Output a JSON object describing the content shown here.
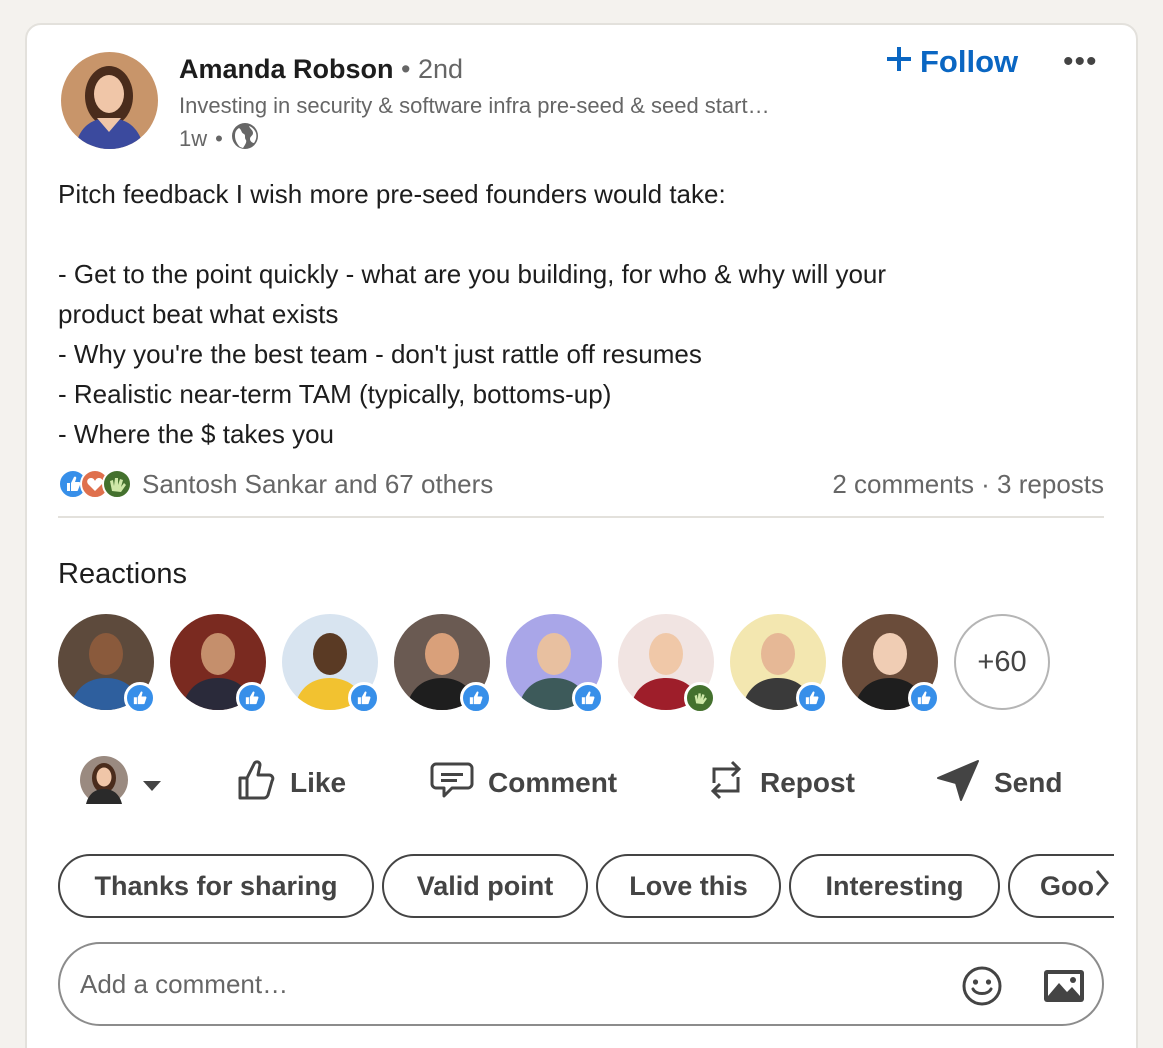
{
  "post": {
    "author_name": "Amanda Robson",
    "author_degree": "• 2nd",
    "author_headline": "Investing in security & software infra pre-seed & seed start…",
    "time": "1w",
    "meta_separator": "•",
    "follow_label": "Follow",
    "more_label": "•••",
    "body_lines": [
      "Pitch feedback I wish more pre-seed founders would take:",
      "",
      "- Get to the point quickly - what are you building, for who & why will your",
      "product beat what exists",
      "- Why you're the best team - don't just rattle off resumes",
      "- Realistic near-term TAM (typically, bottoms-up)",
      "- Where the $ takes you"
    ]
  },
  "social": {
    "reactors_text": "Santosh Sankar and 67 others",
    "counts_text": "2 comments · 3 reposts",
    "reaction_icons": [
      "like-icon",
      "love-icon",
      "celebrate-icon"
    ]
  },
  "reactions": {
    "title": "Reactions",
    "more_count": "+60",
    "people": [
      {
        "reaction": "like",
        "bg": "#5d4a3c",
        "skin": "#8a5a3c",
        "shirt": "#2e5f9e"
      },
      {
        "reaction": "like",
        "bg": "#7a2a20",
        "skin": "#c58f6c",
        "shirt": "#2a2a3a"
      },
      {
        "reaction": "like",
        "bg": "#d8e4f0",
        "skin": "#5a3a24",
        "shirt": "#f2c230"
      },
      {
        "reaction": "like",
        "bg": "#6a5a52",
        "skin": "#d9a07a",
        "shirt": "#1e1e1e"
      },
      {
        "reaction": "like",
        "bg": "#a9a6e8",
        "skin": "#e8c0a0",
        "shirt": "#3d5a5a"
      },
      {
        "reaction": "celebrate",
        "bg": "#f1e4e2",
        "skin": "#f0c8a8",
        "shirt": "#9e1e2a"
      },
      {
        "reaction": "like",
        "bg": "#f3e7b0",
        "skin": "#e6b896",
        "shirt": "#3a3a3a"
      },
      {
        "reaction": "like",
        "bg": "#6a4c3a",
        "skin": "#f0cdb4",
        "shirt": "#1e1e1e"
      }
    ]
  },
  "actions": {
    "like": "Like",
    "comment": "Comment",
    "repost": "Repost",
    "send": "Send"
  },
  "chips": [
    "Thanks for sharing",
    "Valid point",
    "Love this",
    "Interesting",
    "Goo"
  ],
  "comment_box": {
    "placeholder": "Add a comment…"
  },
  "colors": {
    "accent": "#0a66c2",
    "like": "#378fe9",
    "love": "#df704d",
    "celebrate": "#44712e"
  }
}
